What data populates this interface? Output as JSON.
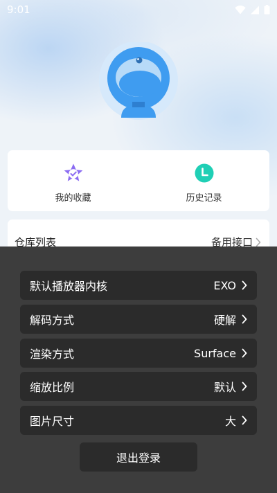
{
  "status_bar": {
    "time": "9:01",
    "wifi_icon": "wifi-icon",
    "signal_icon": "signal-icon",
    "battery_icon": "battery-icon"
  },
  "profile": {
    "avatar_icon": "webcam-avatar-icon"
  },
  "quick_actions": [
    {
      "label": "我的收藏",
      "icon": "star-badge-icon",
      "color": "#8b6cf2"
    },
    {
      "label": "历史记录",
      "icon": "clock-icon",
      "color": "#1fcfb5"
    }
  ],
  "repo": {
    "label": "仓库列表",
    "value": "备用接口"
  },
  "settings_menu": {
    "items": [
      {
        "label": "默认播放器内核",
        "value": "EXO"
      },
      {
        "label": "解码方式",
        "value": "硬解"
      },
      {
        "label": "渲染方式",
        "value": "Surface"
      },
      {
        "label": "缩放比例",
        "value": "默认"
      },
      {
        "label": "图片尺寸",
        "value": "大"
      }
    ],
    "logout_label": "退出登录"
  },
  "colors": {
    "overlay": "#3d3d3d",
    "row": "#2b2b2b",
    "accent_blue": "#3f9cf0"
  }
}
